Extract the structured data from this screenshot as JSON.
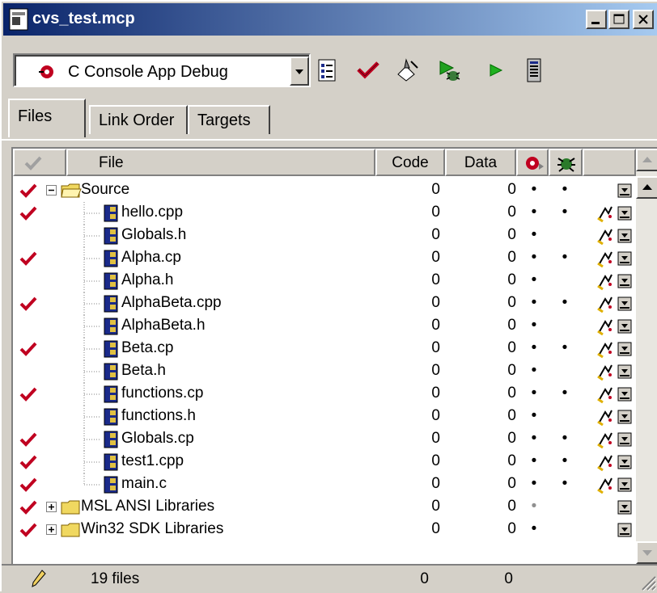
{
  "window": {
    "title": "cvs_test.mcp"
  },
  "toolbar": {
    "target": "C Console App Debug"
  },
  "tabs": [
    {
      "label": "Files",
      "active": true
    },
    {
      "label": "Link Order",
      "active": false
    },
    {
      "label": "Targets",
      "active": false
    }
  ],
  "columns": {
    "file": "File",
    "code": "Code",
    "data": "Data"
  },
  "rows": [
    {
      "name": "Source",
      "kind": "folder",
      "expanded": true,
      "checked": true,
      "code": "0",
      "data": "0",
      "dot1": "•",
      "dot2": "•",
      "debug": false
    },
    {
      "name": "hello.cpp",
      "kind": "file",
      "checked": true,
      "code": "0",
      "data": "0",
      "dot1": "•",
      "dot2": "•",
      "debug": true
    },
    {
      "name": "Globals.h",
      "kind": "file",
      "checked": false,
      "code": "0",
      "data": "0",
      "dot1": "•",
      "dot2": "",
      "debug": true
    },
    {
      "name": "Alpha.cp",
      "kind": "file",
      "checked": true,
      "code": "0",
      "data": "0",
      "dot1": "•",
      "dot2": "•",
      "debug": true
    },
    {
      "name": "Alpha.h",
      "kind": "file",
      "checked": false,
      "code": "0",
      "data": "0",
      "dot1": "•",
      "dot2": "",
      "debug": true
    },
    {
      "name": "AlphaBeta.cpp",
      "kind": "file",
      "checked": true,
      "code": "0",
      "data": "0",
      "dot1": "•",
      "dot2": "•",
      "debug": true
    },
    {
      "name": "AlphaBeta.h",
      "kind": "file",
      "checked": false,
      "code": "0",
      "data": "0",
      "dot1": "•",
      "dot2": "",
      "debug": true
    },
    {
      "name": "Beta.cp",
      "kind": "file",
      "checked": true,
      "code": "0",
      "data": "0",
      "dot1": "•",
      "dot2": "•",
      "debug": true
    },
    {
      "name": "Beta.h",
      "kind": "file",
      "checked": false,
      "code": "0",
      "data": "0",
      "dot1": "•",
      "dot2": "",
      "debug": true
    },
    {
      "name": "functions.cp",
      "kind": "file",
      "checked": true,
      "code": "0",
      "data": "0",
      "dot1": "•",
      "dot2": "•",
      "debug": true
    },
    {
      "name": "functions.h",
      "kind": "file",
      "checked": false,
      "code": "0",
      "data": "0",
      "dot1": "•",
      "dot2": "",
      "debug": true
    },
    {
      "name": "Globals.cp",
      "kind": "file",
      "checked": true,
      "code": "0",
      "data": "0",
      "dot1": "•",
      "dot2": "•",
      "debug": true
    },
    {
      "name": "test1.cpp",
      "kind": "file",
      "checked": true,
      "code": "0",
      "data": "0",
      "dot1": "•",
      "dot2": "•",
      "debug": true
    },
    {
      "name": "main.c",
      "kind": "file",
      "checked": true,
      "code": "0",
      "data": "0",
      "dot1": "•",
      "dot2": "•",
      "debug": true
    },
    {
      "name": "MSL ANSI Libraries",
      "kind": "folder",
      "expanded": false,
      "checked": true,
      "code": "0",
      "data": "0",
      "dot1": "•",
      "dot1_grey": true,
      "dot2": "",
      "debug": false
    },
    {
      "name": "Win32 SDK Libraries",
      "kind": "folder",
      "expanded": false,
      "checked": true,
      "code": "0",
      "data": "0",
      "dot1": "•",
      "dot2": "",
      "debug": false
    }
  ],
  "status": {
    "files": "19 files",
    "code_total": "0",
    "data_total": "0"
  },
  "colors": {
    "check": "#c00020",
    "folder": "#f0d860",
    "file_icon": "#1a2a8a",
    "title_start": "#0a246a",
    "title_end": "#a6caf0"
  }
}
